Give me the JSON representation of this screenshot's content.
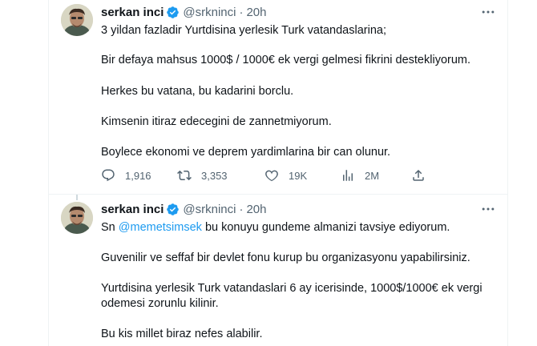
{
  "tweets": [
    {
      "author_name": "serkan inci",
      "handle": "@srkninci",
      "separator": "·",
      "time": "20h",
      "paragraphs": [
        "3 yildan fazladir Yurtdisina yerlesik Turk vatandaslarina;",
        "Bir defaya mahsus 1000$ / 1000€ ek vergi gelmesi fikrini destekliyorum.",
        "Herkes bu vatana, bu kadarini borclu.",
        "Kimsenin itiraz edecegini de zannetmiyorum.",
        "Boylece ekonomi ve deprem yardimlarina bir can olunur."
      ],
      "actions": {
        "reply_count": "1,916",
        "retweet_count": "3,353",
        "like_count": "19K",
        "view_count": "2M"
      }
    },
    {
      "author_name": "serkan inci",
      "handle": "@srkninci",
      "separator": "·",
      "time": "20h",
      "intro_prefix": "Sn ",
      "mention": "@memetsimsek",
      "intro_suffix": " bu konuyu gundeme almanizi tavsiye ediyorum.",
      "paragraphs": [
        "Guvenilir ve seffaf bir devlet fonu kurup bu organizasyonu yapabilirsiniz.",
        "Yurtdisina yerlesik Turk vatandaslari 6 ay icerisinde, 1000$/1000€ ek vergi",
        "odemesi zorunlu kilinir.",
        "Bu kis millet biraz nefes alabilir."
      ]
    }
  ],
  "icons": {
    "verified": "verified-badge-icon",
    "more": "more-options-icon",
    "reply": "reply-icon",
    "retweet": "retweet-icon",
    "like": "like-icon",
    "views": "views-icon",
    "share": "share-icon"
  },
  "colors": {
    "accent": "#1d9bf0",
    "text_primary": "#0f1419",
    "text_secondary": "#536471",
    "border": "#eff3f4"
  }
}
